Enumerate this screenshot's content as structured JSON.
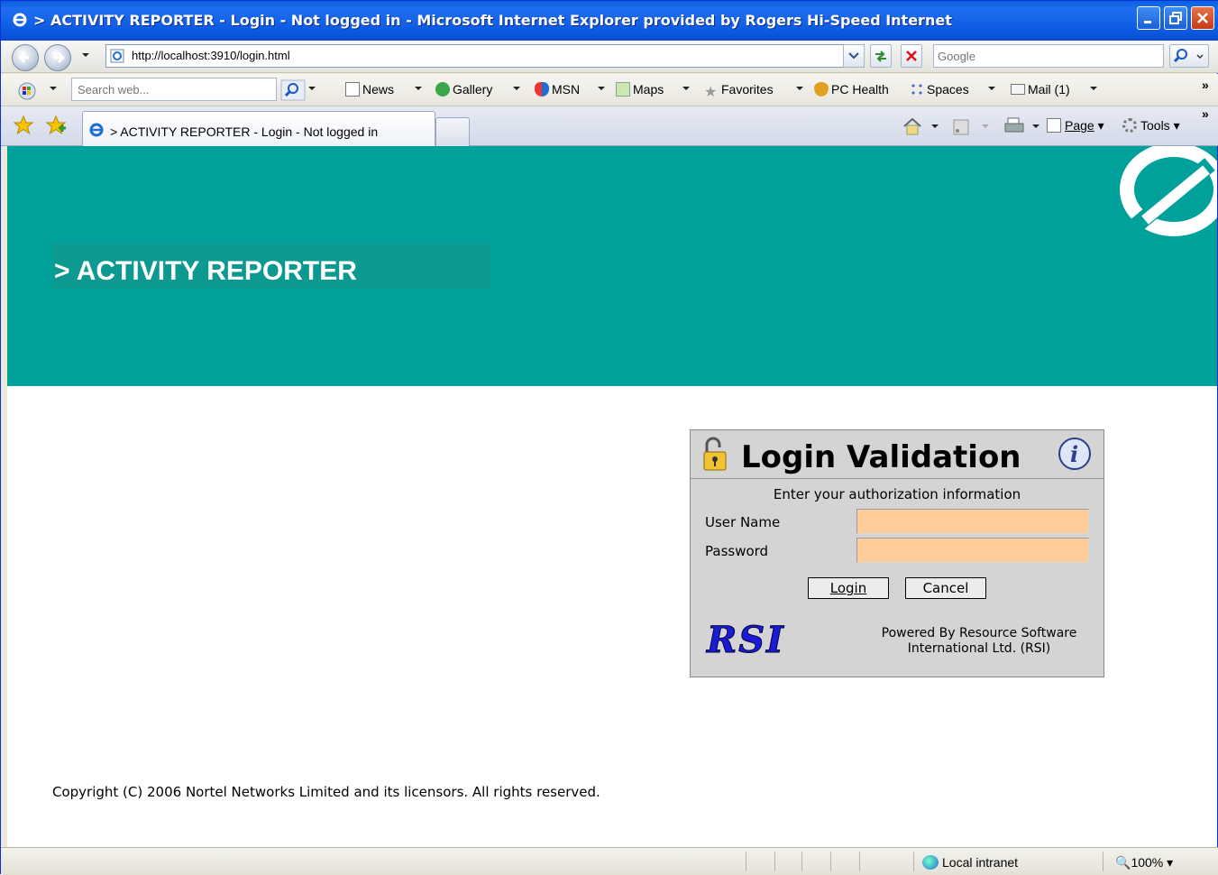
{
  "window": {
    "title": "> ACTIVITY REPORTER - Login - Not logged in - Microsoft Internet Explorer provided by Rogers Hi-Speed Internet"
  },
  "address_bar": {
    "url": "http://localhost:3910/login.html",
    "search_placeholder": "Google"
  },
  "links_toolbar": {
    "search_placeholder": "Search web...",
    "items": [
      "News",
      "Gallery",
      "MSN",
      "Maps",
      "Favorites",
      "PC Health",
      "Spaces",
      "Mail (1)"
    ]
  },
  "tabs": {
    "active_label": "> ACTIVITY REPORTER - Login - Not logged in"
  },
  "command_bar": {
    "page_label": "Page",
    "tools_label": "Tools"
  },
  "page": {
    "banner_title": "> ACTIVITY REPORTER",
    "login": {
      "title": "Login Validation",
      "subtitle": "Enter your authorization information",
      "username_label": "User Name",
      "password_label": "Password",
      "username_value": "",
      "password_value": "",
      "login_button": "Login",
      "cancel_button": "Cancel",
      "logo_text": "RSI",
      "powered_line1": "Powered By Resource Software",
      "powered_line2": "International Ltd. (RSI)"
    },
    "copyright": "Copyright (C) 2006 Nortel Networks Limited and its licensors.  All rights reserved."
  },
  "status_bar": {
    "zone": "Local intranet",
    "zoom": "100%"
  },
  "colors": {
    "banner": "#00a19a",
    "title_bar": "#0a5fde",
    "field_fill": "#fdcc99"
  }
}
